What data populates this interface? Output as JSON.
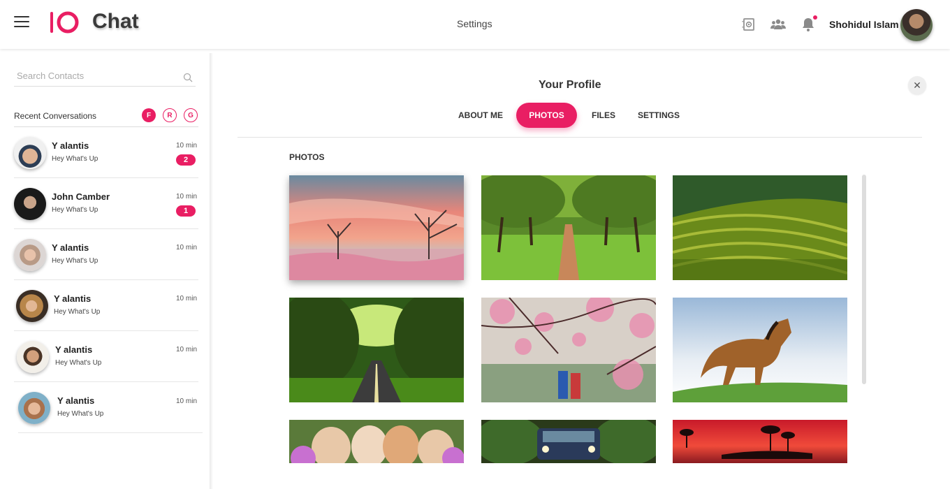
{
  "header": {
    "app_name": "Chat",
    "settings_label": "Settings",
    "user_name": "Shohidul Islam"
  },
  "colors": {
    "accent": "#e91e63"
  },
  "sidebar": {
    "search_placeholder": "Search Contacts",
    "recent_label": "Recent Conversations",
    "filters": [
      "F",
      "R",
      "G"
    ],
    "conversations": [
      {
        "name": "Y alantis",
        "message": "Hey What's Up",
        "time": "10 min",
        "unread": "2"
      },
      {
        "name": "John Camber",
        "message": "Hey What's Up",
        "time": "10 min",
        "unread": "1"
      },
      {
        "name": "Y alantis",
        "message": "Hey What's Up",
        "time": "10 min",
        "unread": ""
      },
      {
        "name": "Y alantis",
        "message": "Hey What's Up",
        "time": "10 min",
        "unread": ""
      },
      {
        "name": "Y alantis",
        "message": "Hey What's Up",
        "time": "10 min",
        "unread": ""
      },
      {
        "name": "Y alantis",
        "message": "Hey What's Up",
        "time": "10 min",
        "unread": ""
      }
    ]
  },
  "profile": {
    "title": "Your Profile",
    "close_label": "✕",
    "tabs": [
      "ABOUT ME",
      "PHOTOS",
      "FILES",
      "SETTINGS"
    ],
    "active_tab": "PHOTOS",
    "section_title": "PHOTOS"
  }
}
